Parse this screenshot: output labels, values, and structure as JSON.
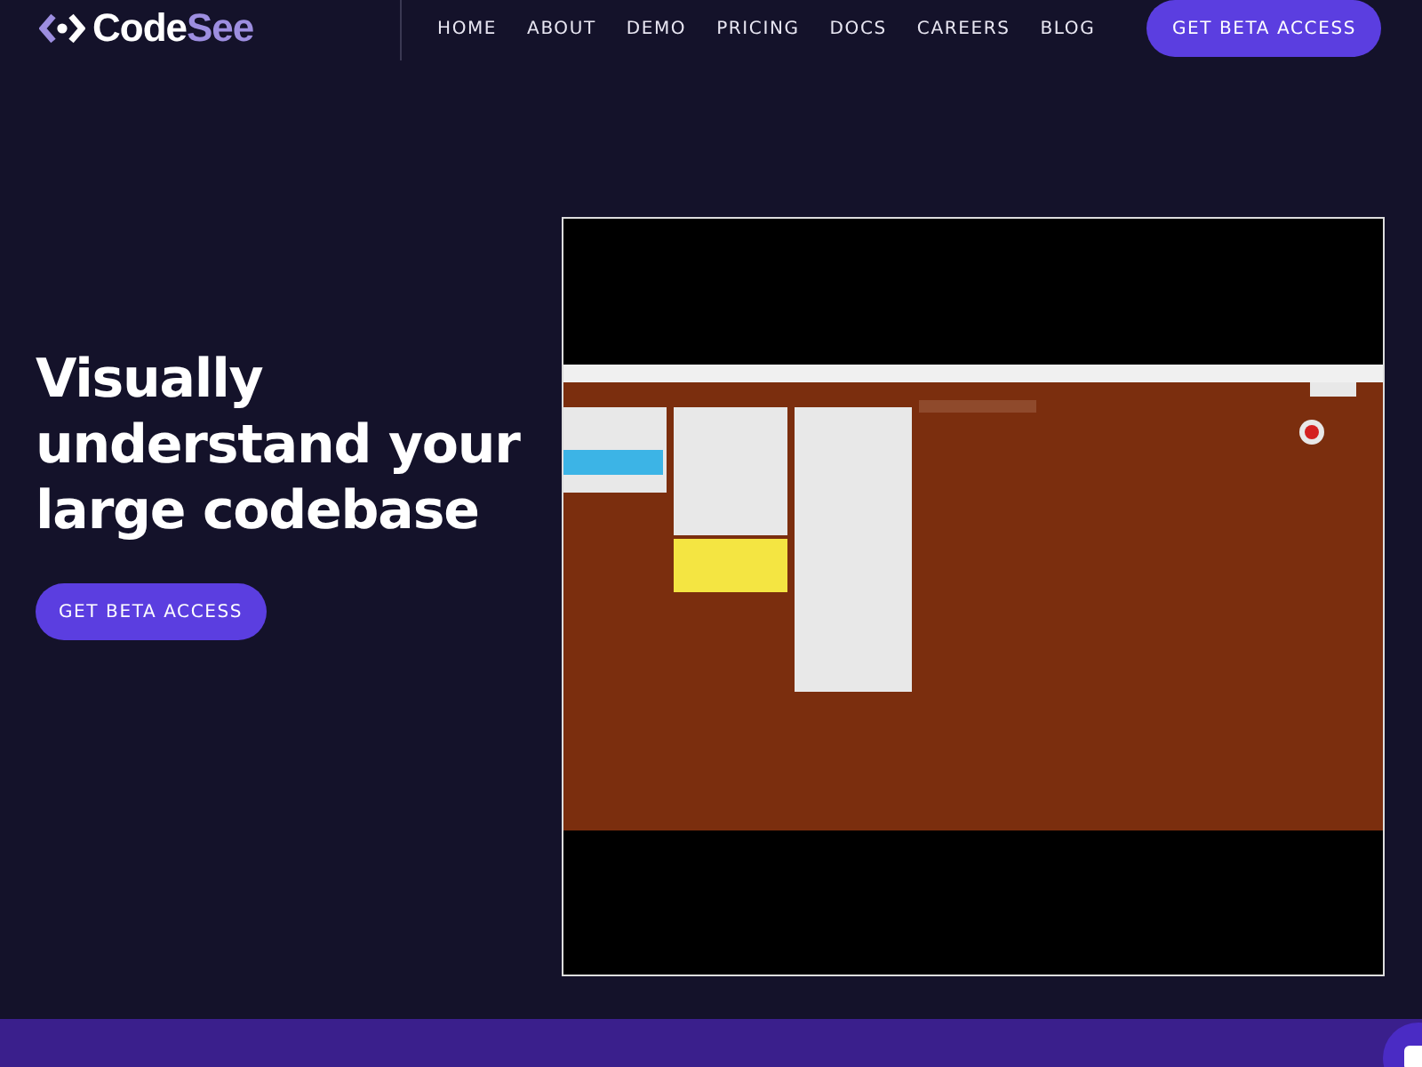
{
  "header": {
    "logo": {
      "primary": "Code",
      "accent": "See"
    },
    "nav": [
      {
        "label": "HOME"
      },
      {
        "label": "ABOUT"
      },
      {
        "label": "DEMO"
      },
      {
        "label": "PRICING"
      },
      {
        "label": "DOCS"
      },
      {
        "label": "CAREERS"
      },
      {
        "label": "BLOG"
      }
    ],
    "cta": "GET BETA ACCESS"
  },
  "hero": {
    "headline_lines": [
      "Visually",
      "understand your",
      "large codebase"
    ],
    "cta": "GET BETA ACCESS"
  }
}
